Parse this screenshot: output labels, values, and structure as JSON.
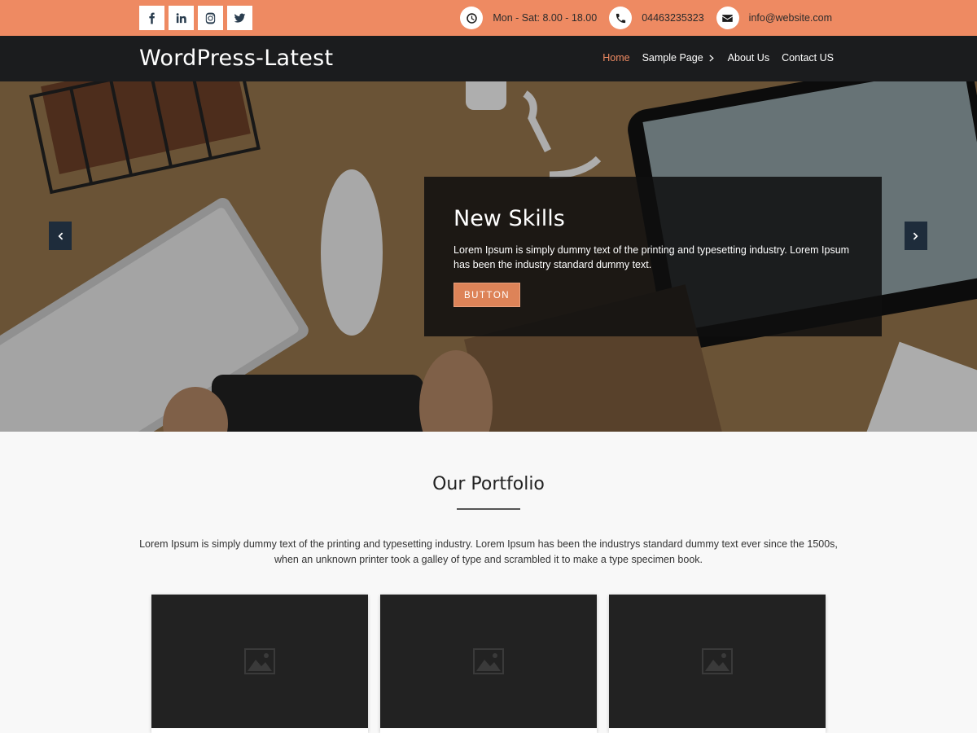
{
  "topbar": {
    "socials": [
      {
        "icon": "facebook-icon"
      },
      {
        "icon": "linkedin-icon"
      },
      {
        "icon": "instagram-icon"
      },
      {
        "icon": "twitter-icon"
      }
    ],
    "hours": "Mon - Sat: 8.00 - 18.00",
    "phone": "04463235323",
    "email": "info@website.com"
  },
  "header": {
    "site_title": "WordPress-Latest",
    "nav": [
      {
        "label": "Home",
        "active": true
      },
      {
        "label": "Sample Page",
        "has_dropdown": true
      },
      {
        "label": "About Us"
      },
      {
        "label": "Contact US"
      }
    ]
  },
  "hero": {
    "title": "New Skills",
    "text": "Lorem Ipsum is simply dummy text of the printing and typesetting industry. Lorem Ipsum has been the industry standard dummy text.",
    "button": "BUTTON"
  },
  "portfolio": {
    "title": "Our Portfolio",
    "description": "Lorem Ipsum is simply dummy text of the printing and typesetting industry. Lorem Ipsum has been the industrys standard dummy text ever since the 1500s, when an unknown printer took a galley of type and scrambled it to make a type specimen book.",
    "cards": [
      {
        "icon": "image-placeholder-icon"
      },
      {
        "icon": "image-placeholder-icon"
      },
      {
        "icon": "image-placeholder-icon"
      }
    ]
  },
  "colors": {
    "accent": "#ee8a62",
    "header_bg": "#1b1c1e",
    "button": "#dd8358"
  }
}
